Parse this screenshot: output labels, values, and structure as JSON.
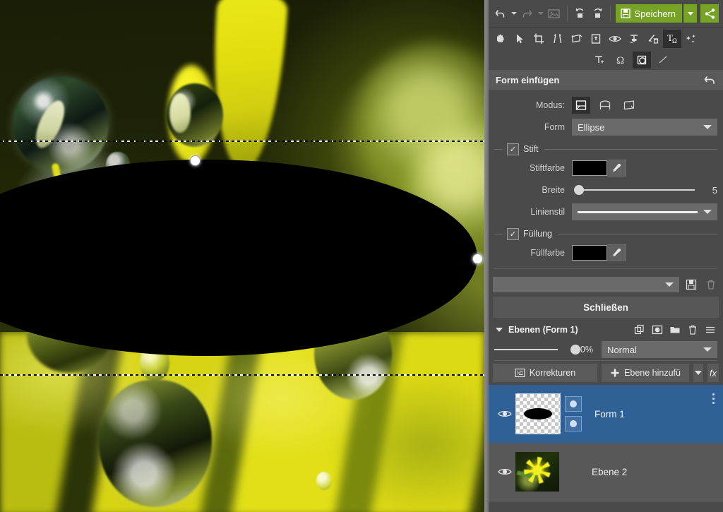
{
  "app": {
    "toolbar": {
      "undo_icon": "undo-icon",
      "undo_caret_icon": "chevron-down-icon",
      "redo_icon": "redo-icon",
      "redo_caret_icon": "chevron-down-icon",
      "image_icon": "image-icon",
      "rotate_left_icon": "rotate-left-icon",
      "rotate_right_icon": "rotate-right-icon",
      "save_label": "Speichern",
      "save_icon": "floppy-disk-icon",
      "save_caret_icon": "chevron-down-icon",
      "share_icon": "share-icon",
      "accent_green": "#76a226"
    },
    "tools": [
      {
        "name": "hand-tool",
        "icon": "hand-icon"
      },
      {
        "name": "select-tool",
        "icon": "cursor-arrow-icon"
      },
      {
        "name": "crop-tool",
        "icon": "crop-icon"
      },
      {
        "name": "straighten-tool",
        "icon": "straighten-icon"
      },
      {
        "name": "transform-tool",
        "icon": "transform-icon"
      },
      {
        "name": "frame-tool",
        "icon": "frame-icon"
      },
      {
        "name": "redeye-tool",
        "icon": "eye-icon"
      },
      {
        "name": "clone-tool",
        "icon": "clone-stamp-icon"
      },
      {
        "name": "retouch-tool",
        "icon": "retouch-brush-icon"
      },
      {
        "name": "text-tool",
        "icon": "text-omega-icon",
        "active": true
      },
      {
        "name": "effects-tool",
        "icon": "sparkle-icon"
      }
    ],
    "subtools": [
      {
        "name": "add-text-tool",
        "icon": "text-plus-icon"
      },
      {
        "name": "symbol-tool",
        "icon": "omega-icon"
      },
      {
        "name": "shape-tool",
        "icon": "shape-icon",
        "active": true
      },
      {
        "name": "line-tool",
        "icon": "line-icon"
      }
    ]
  },
  "shape_panel": {
    "title": "Form einfügen",
    "back_icon": "back-arrow-icon",
    "mode_label": "Modus:",
    "modes": [
      {
        "name": "mode-new-shape",
        "icon": "shape-mode-new-icon",
        "active": true
      },
      {
        "name": "mode-add-shape",
        "icon": "shape-mode-add-icon",
        "active": false
      },
      {
        "name": "mode-warp-shape",
        "icon": "shape-mode-warp-icon",
        "active": false
      }
    ],
    "form_label": "Form",
    "form_value": "Ellipse",
    "pen_group_label": "Stift",
    "pen_group_checked": true,
    "pen_color_label": "Stiftfarbe",
    "pen_color": "#000000",
    "width_label": "Breite",
    "width_value": "5",
    "linestyle_label": "Linienstil",
    "fill_group_label": "Füllung",
    "fill_group_checked": true,
    "fill_color_label": "Füllfarbe",
    "fill_color": "#000000",
    "preset_value": "",
    "preset_save_icon": "floppy-disk-icon",
    "preset_delete_icon": "trash-icon",
    "close_label": "Schließen"
  },
  "layers_panel": {
    "title": "Ebenen (Form 1)",
    "collapse_icon": "chevron-down-icon",
    "header_icons": [
      {
        "name": "duplicate-layer-icon",
        "icon": "duplicate-icon"
      },
      {
        "name": "add-mask-icon",
        "icon": "mask-icon"
      },
      {
        "name": "new-group-icon",
        "icon": "folder-icon"
      },
      {
        "name": "delete-layer-icon",
        "icon": "trash-icon"
      },
      {
        "name": "layers-menu-icon",
        "icon": "hamburger-icon"
      }
    ],
    "opacity_value": "100%",
    "blend_mode": "Normal",
    "corrections_label": "Korrekturen",
    "corrections_icon": "corrections-icon",
    "add_layer_label": "Ebene hinzufü",
    "add_layer_icon": "plus-icon",
    "add_layer_caret_icon": "chevron-down-icon",
    "fx_label": "fx",
    "selected_color": "#2f6096",
    "layers": [
      {
        "name": "Form 1",
        "visible_icon": "eye-icon",
        "selected": true,
        "thumb": "checker-ellipse",
        "mask_icons": [
          "layer-link-icon",
          "layer-mask-icon"
        ],
        "menu_icon": "kebab-menu-icon"
      },
      {
        "name": "Ebene 2",
        "visible_icon": "eye-icon",
        "selected": false,
        "thumb": "photo"
      }
    ]
  },
  "canvas": {
    "shape_name": "ellipse-shape",
    "shape_fill": "#000000",
    "handles": [
      "top-handle",
      "right-handle"
    ],
    "guides": [
      "top-guide",
      "bottom-guide"
    ]
  }
}
